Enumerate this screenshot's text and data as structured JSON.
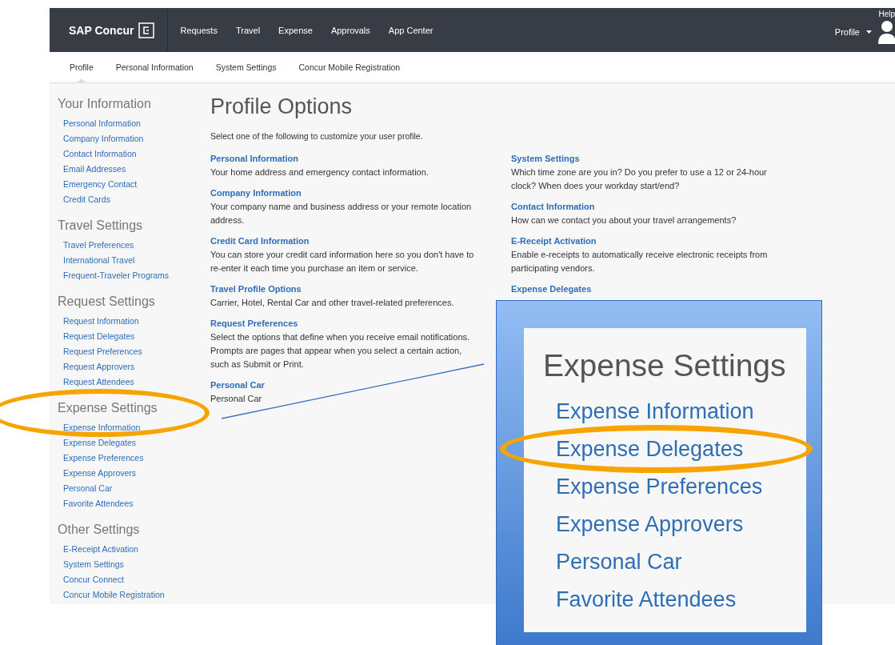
{
  "topbar": {
    "logo": "SAP Concur",
    "nav": [
      "Requests",
      "Travel",
      "Expense",
      "Approvals",
      "App Center"
    ],
    "help": "Help",
    "profile": "Profile"
  },
  "subnav": [
    {
      "label": "Profile",
      "selected": true
    },
    {
      "label": "Personal Information",
      "selected": false
    },
    {
      "label": "System Settings",
      "selected": false
    },
    {
      "label": "Concur Mobile Registration",
      "selected": false
    }
  ],
  "sidebar": [
    {
      "heading": "Your Information",
      "items": [
        "Personal Information",
        "Company Information",
        "Contact Information",
        "Email Addresses",
        "Emergency Contact",
        "Credit Cards"
      ]
    },
    {
      "heading": "Travel Settings",
      "items": [
        "Travel Preferences",
        "International Travel",
        "Frequent-Traveler Programs"
      ]
    },
    {
      "heading": "Request Settings",
      "items": [
        "Request Information",
        "Request Delegates",
        "Request Preferences",
        "Request Approvers",
        "Request Attendees"
      ]
    },
    {
      "heading": "Expense Settings",
      "items": [
        "Expense Information",
        "Expense Delegates",
        "Expense Preferences",
        "Expense Approvers",
        "Personal Car",
        "Favorite Attendees"
      ]
    },
    {
      "heading": "Other Settings",
      "items": [
        "E-Receipt Activation",
        "System Settings",
        "Concur Connect",
        "Concur Mobile Registration"
      ]
    }
  ],
  "main": {
    "title": "Profile Options",
    "intro": "Select one of the following to customize your user profile.",
    "columns": [
      [
        {
          "title": "Personal Information",
          "description": "Your home address and emergency contact information."
        },
        {
          "title": "Company Information",
          "description": "Your company name and business address or your remote location address."
        },
        {
          "title": "Credit Card Information",
          "description": "You can store your credit card information here so you don't have to re-enter it each time you purchase an item or service."
        },
        {
          "title": "Travel Profile Options",
          "description": "Carrier, Hotel, Rental Car and other travel-related preferences."
        },
        {
          "title": "Request Preferences",
          "description": "Select the options that define when you receive email notifications. Prompts are pages that appear when you select a certain action, such as Submit or Print."
        },
        {
          "title": "Personal Car",
          "description": "Personal Car"
        }
      ],
      [
        {
          "title": "System Settings",
          "description": "Which time zone are you in? Do you prefer to use a 12 or 24-hour clock? When does your workday start/end?"
        },
        {
          "title": "Contact Information",
          "description": "How can we contact you about your travel arrangements?"
        },
        {
          "title": "E-Receipt Activation",
          "description": "Enable e-receipts to automatically receive electronic receipts from participating vendors."
        },
        {
          "title": "Expense Delegates"
        }
      ]
    ]
  },
  "callout": {
    "heading": "Expense Settings",
    "items": [
      "Expense Information",
      "Expense Delegates",
      "Expense Preferences",
      "Expense Approvers",
      "Personal Car",
      "Favorite Attendees"
    ]
  }
}
